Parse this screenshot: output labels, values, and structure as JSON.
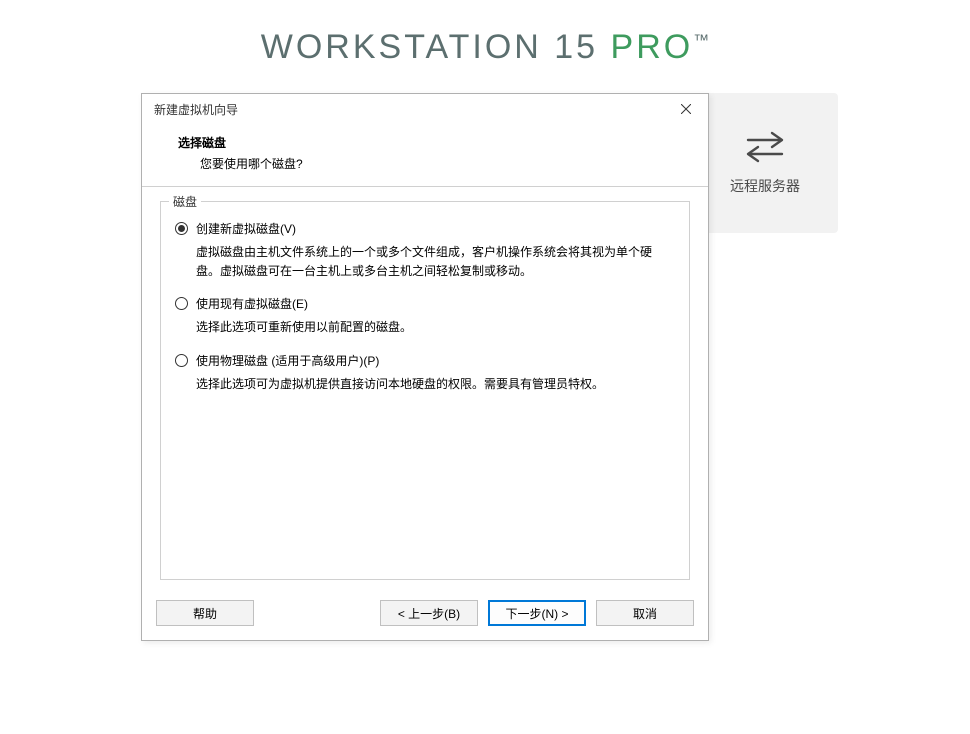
{
  "background": {
    "title_prefix": "WORKSTATION 15 ",
    "title_suffix": "PRO",
    "tm": "™",
    "card_label": "远程服务器"
  },
  "dialog": {
    "window_title": "新建虚拟机向导",
    "header": {
      "title": "选择磁盘",
      "subtitle": "您要使用哪个磁盘?"
    },
    "group_label": "磁盘",
    "options": [
      {
        "label": "创建新虚拟磁盘(V)",
        "description": "虚拟磁盘由主机文件系统上的一个或多个文件组成，客户机操作系统会将其视为单个硬盘。虚拟磁盘可在一台主机上或多台主机之间轻松复制或移动。",
        "checked": true
      },
      {
        "label": "使用现有虚拟磁盘(E)",
        "description": "选择此选项可重新使用以前配置的磁盘。",
        "checked": false
      },
      {
        "label": "使用物理磁盘 (适用于高级用户)(P)",
        "description": "选择此选项可为虚拟机提供直接访问本地硬盘的权限。需要具有管理员特权。",
        "checked": false
      }
    ],
    "buttons": {
      "help": "帮助",
      "back": "< 上一步(B)",
      "next": "下一步(N) >",
      "cancel": "取消"
    }
  }
}
